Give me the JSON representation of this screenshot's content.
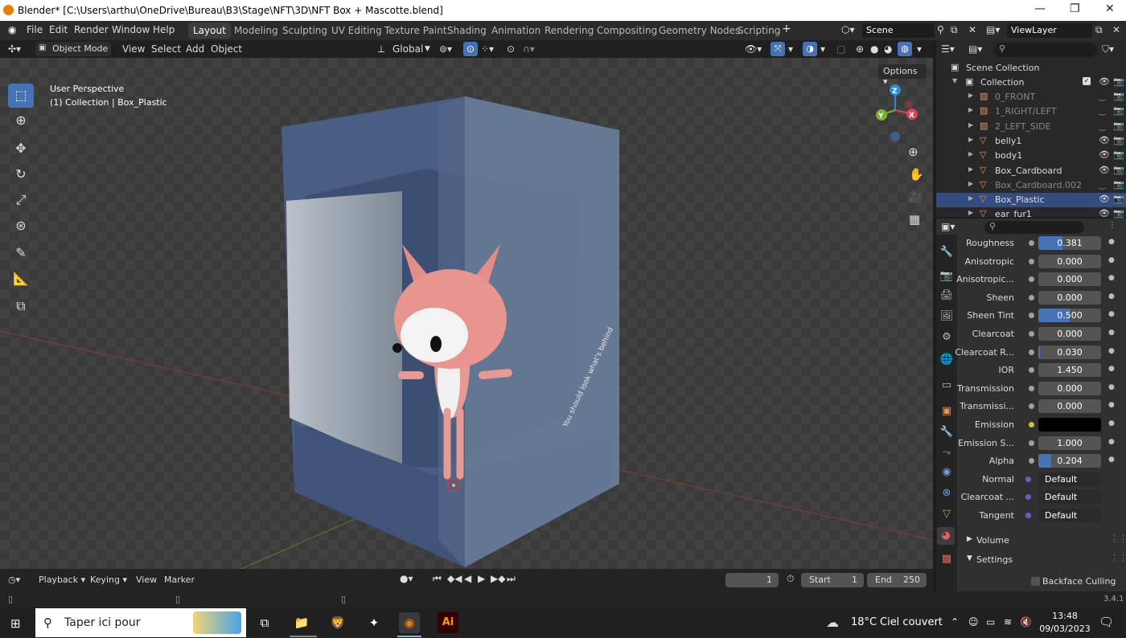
{
  "window": {
    "title": "Blender* [C:\\Users\\arthu\\OneDrive\\Bureau\\B3\\Stage\\NFT\\3D\\NFT Box + Mascotte.blend]"
  },
  "menu": [
    "File",
    "Edit",
    "Render",
    "Window",
    "Help"
  ],
  "workspace_tabs": [
    "Layout",
    "Modeling",
    "Sculpting",
    "UV Editing",
    "Texture Paint",
    "Shading",
    "Animation",
    "Rendering",
    "Compositing",
    "Geometry Nodes",
    "Scripting"
  ],
  "scene": {
    "name": "Scene",
    "view_layer": "ViewLayer"
  },
  "viewport_header": {
    "mode": "Object Mode",
    "menus": [
      "View",
      "Select",
      "Add",
      "Object"
    ],
    "transform": "Global",
    "options": "Options"
  },
  "viewport": {
    "perspective": "User Perspective",
    "context": "(1) Collection | Box_Plastic",
    "box_text": "You should look what's behind",
    "gizmo": {
      "z": "Z",
      "y": "Y",
      "x": "X"
    }
  },
  "outliner": {
    "root": "Scene Collection",
    "collection": "Collection",
    "items": [
      {
        "name": "0_FRONT",
        "dim": true
      },
      {
        "name": "1_RIGHT/LEFT",
        "dim": true
      },
      {
        "name": "2_LEFT_SIDE",
        "dim": true
      },
      {
        "name": "belly1",
        "dim": false
      },
      {
        "name": "body1",
        "dim": false
      },
      {
        "name": "Box_Cardboard",
        "dim": false
      },
      {
        "name": "Box_Cardboard.002",
        "dim": true
      },
      {
        "name": "Box_Plastic",
        "dim": false
      },
      {
        "name": "ear_fur1",
        "dim": false
      }
    ]
  },
  "properties": {
    "rows": [
      {
        "label": "Roughness",
        "value": "0.381",
        "fill": 0.381,
        "dot": "#a0a0a0"
      },
      {
        "label": "Anisotropic",
        "value": "0.000",
        "fill": 0,
        "dot": "#a0a0a0"
      },
      {
        "label": "Anisotropic...",
        "value": "0.000",
        "fill": 0,
        "dot": "#a0a0a0"
      },
      {
        "label": "Sheen",
        "value": "0.000",
        "fill": 0,
        "dot": "#a0a0a0"
      },
      {
        "label": "Sheen Tint",
        "value": "0.500",
        "fill": 0.5,
        "dot": "#a0a0a0"
      },
      {
        "label": "Clearcoat",
        "value": "0.000",
        "fill": 0,
        "dot": "#a0a0a0"
      },
      {
        "label": "Clearcoat R...",
        "value": "0.030",
        "fill": 0.03,
        "dot": "#a0a0a0"
      },
      {
        "label": "IOR",
        "value": "1.450",
        "fill": 0,
        "dot": "#a0a0a0"
      },
      {
        "label": "Transmission",
        "value": "0.000",
        "fill": 0,
        "dot": "#a0a0a0"
      },
      {
        "label": "Transmissi...",
        "value": "0.000",
        "fill": 0,
        "dot": "#a0a0a0"
      },
      {
        "label": "Emission",
        "value": "",
        "fill": 0,
        "dot": "#c7c729",
        "color": "#000000"
      },
      {
        "label": "Emission S...",
        "value": "1.000",
        "fill": 0,
        "dot": "#a0a0a0"
      },
      {
        "label": "Alpha",
        "value": "0.204",
        "fill": 0.204,
        "dot": "#a0a0a0"
      },
      {
        "label": "Normal",
        "value": "Default",
        "fill": 0,
        "dot": "#6363c7",
        "link": true
      },
      {
        "label": "Clearcoat ...",
        "value": "Default",
        "fill": 0,
        "dot": "#6363c7",
        "link": true
      },
      {
        "label": "Tangent",
        "value": "Default",
        "fill": 0,
        "dot": "#6363c7",
        "link": true
      }
    ],
    "sections": [
      "Volume",
      "Settings"
    ],
    "backface": "Backface Culling"
  },
  "timeline": {
    "menus": [
      "Playback",
      "Keying",
      "View",
      "Marker"
    ],
    "current_frame": "1",
    "start_label": "Start",
    "start": "1",
    "end_label": "End",
    "end": "250"
  },
  "status": {
    "version": "3.4.1"
  },
  "taskbar": {
    "search_placeholder": "Taper ici pour",
    "weather_temp": "18°C",
    "weather_desc": "Ciel couvert",
    "time": "13:48",
    "date": "09/03/2023"
  }
}
